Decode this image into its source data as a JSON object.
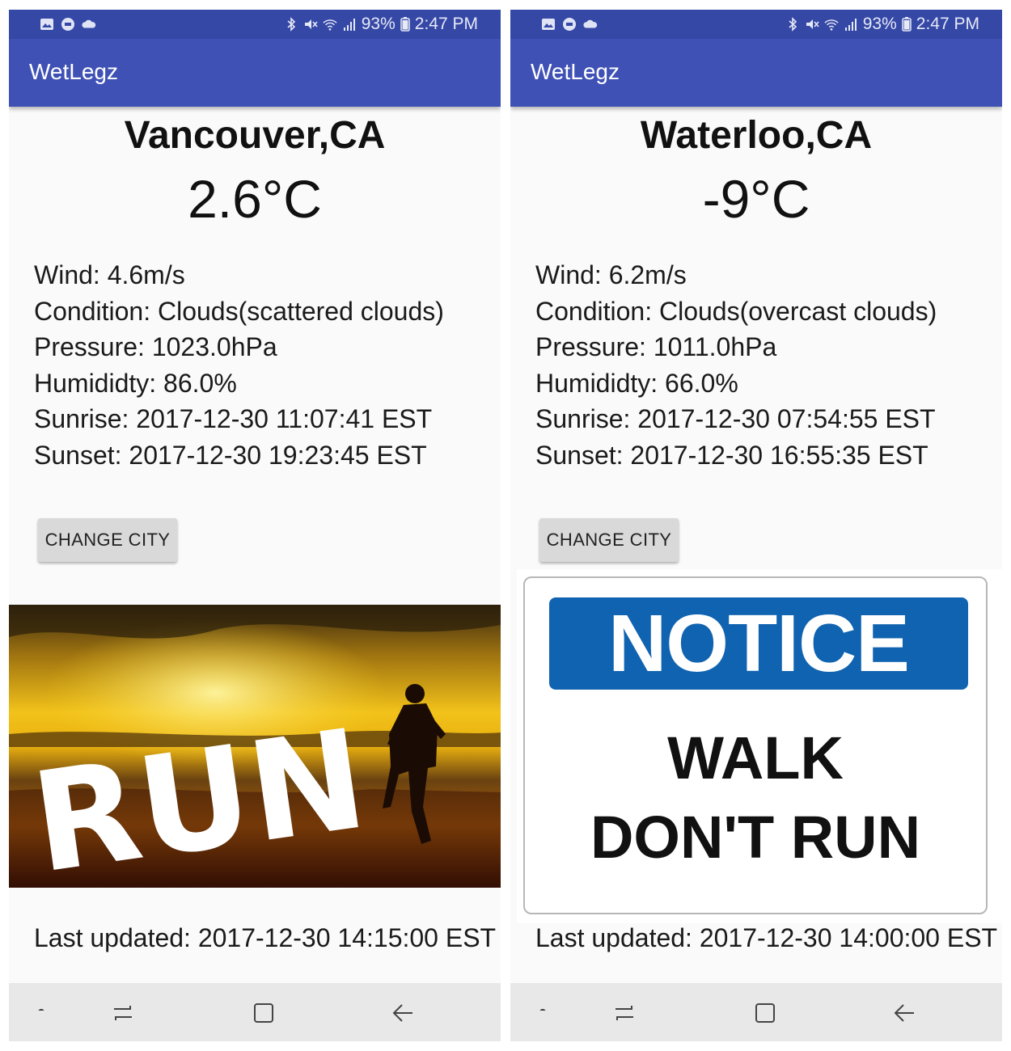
{
  "status_bar": {
    "battery": "93%",
    "time": "2:47 PM"
  },
  "app": {
    "title": "WetLegz"
  },
  "screens": [
    {
      "city": "Vancouver,CA",
      "temperature": "2.6°C",
      "details": [
        "Wind: 4.6m/s",
        "Condition: Clouds(scattered clouds)",
        "Pressure: 1023.0hPa",
        "Humididty: 86.0%",
        "Sunrise: 2017-12-30 11:07:41 EST",
        "Sunset: 2017-12-30 19:23:45 EST"
      ],
      "button_label": "CHANGE CITY",
      "image_text": "RUN",
      "last_updated": "Last updated: 2017-12-30 14:15:00 EST"
    },
    {
      "city": "Waterloo,CA",
      "temperature": "-9°C",
      "details": [
        "Wind: 6.2m/s",
        "Condition: Clouds(overcast clouds)",
        "Pressure: 1011.0hPa",
        "Humididty: 66.0%",
        "Sunrise: 2017-12-30 07:54:55 EST",
        "Sunset: 2017-12-30 16:55:35 EST"
      ],
      "button_label": "CHANGE CITY",
      "sign": {
        "banner": "NOTICE",
        "line1": "WALK",
        "line2": "DON'T RUN"
      },
      "last_updated": "Last updated: 2017-12-30 14:00:00 EST"
    }
  ],
  "colors": {
    "app_bar": "#3f51b5",
    "status_bar": "#3548a6",
    "notice_blue": "#1063b0"
  }
}
